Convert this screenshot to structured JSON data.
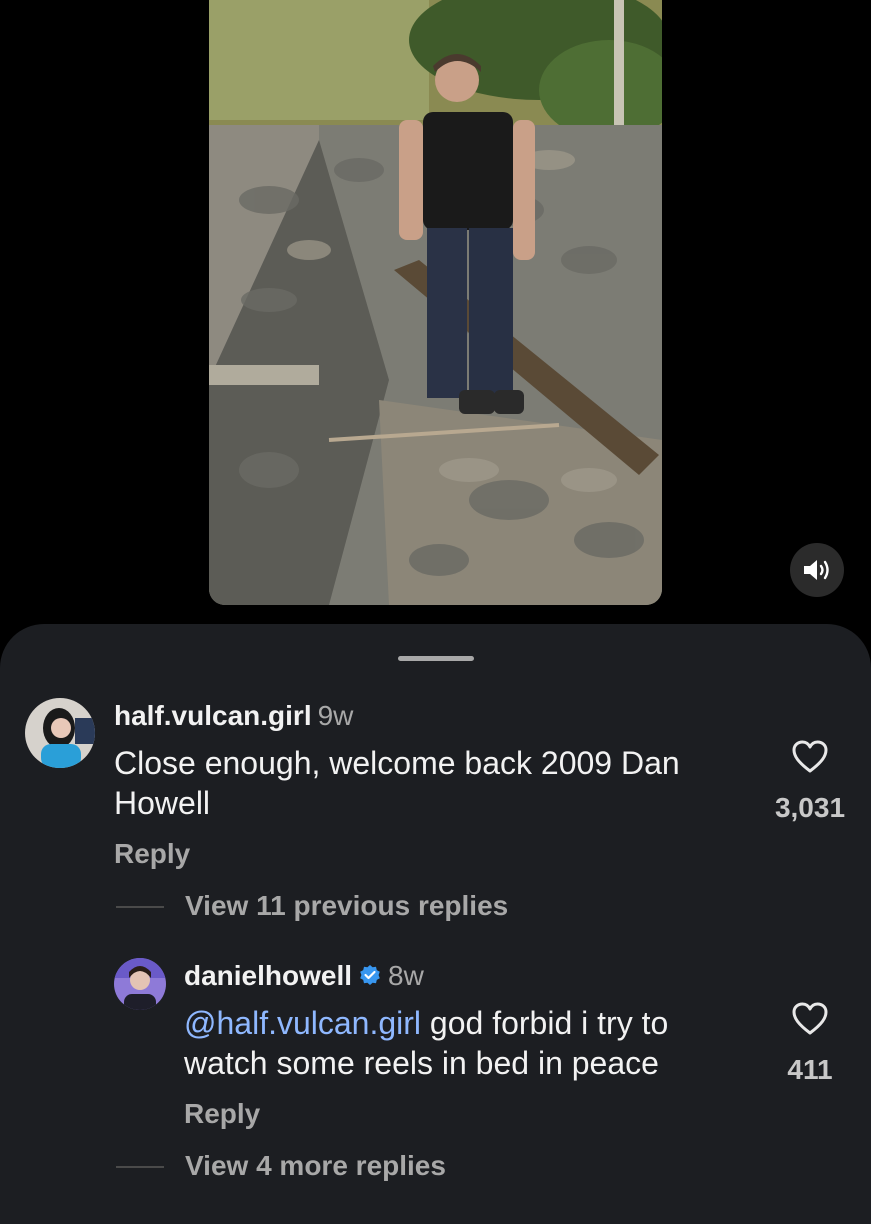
{
  "media": {
    "sound_icon": "speaker-icon"
  },
  "comments": [
    {
      "username": "half.vulcan.girl",
      "time": "9w",
      "text_line1": "Close enough, welcome back 2009 Dan",
      "text_line2": "Howell",
      "reply_label": "Reply",
      "likes": "3,031",
      "view_replies_label": "View 11 previous replies"
    },
    {
      "username": "danielhowell",
      "verified": true,
      "time": "8w",
      "mention": "@half.vulcan.girl",
      "text_line1_rest": " god forbid i try to",
      "text_line2": "watch some reels in bed in peace",
      "reply_label": "Reply",
      "likes": "411",
      "view_replies_label": "View 4 more replies"
    }
  ],
  "colors": {
    "sheet_bg": "#1c1e22",
    "mention": "#8fb8ff",
    "verified": "#3897f0",
    "muted_text": "#a8a8a8"
  }
}
